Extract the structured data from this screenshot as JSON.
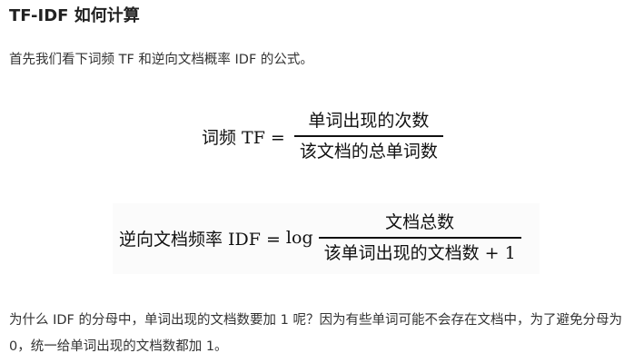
{
  "heading": "TF-IDF 如何计算",
  "intro": "首先我们看下词频 TF 和逆向文档概率 IDF 的公式。",
  "formula_tf": {
    "lhs": "词频 TF =",
    "numerator": "单词出现的次数",
    "denominator": "该文档的总单词数"
  },
  "formula_idf": {
    "lhs": "逆向文档频率 IDF =",
    "fn": "log",
    "numerator": "文档总数",
    "denominator": "该单词出现的文档数 + 1"
  },
  "outro": "为什么 IDF 的分母中，单词出现的文档数要加 1 呢？因为有些单词可能不会存在文档中，为了避免分母为 0，统一给单词出现的文档数都加 1。"
}
